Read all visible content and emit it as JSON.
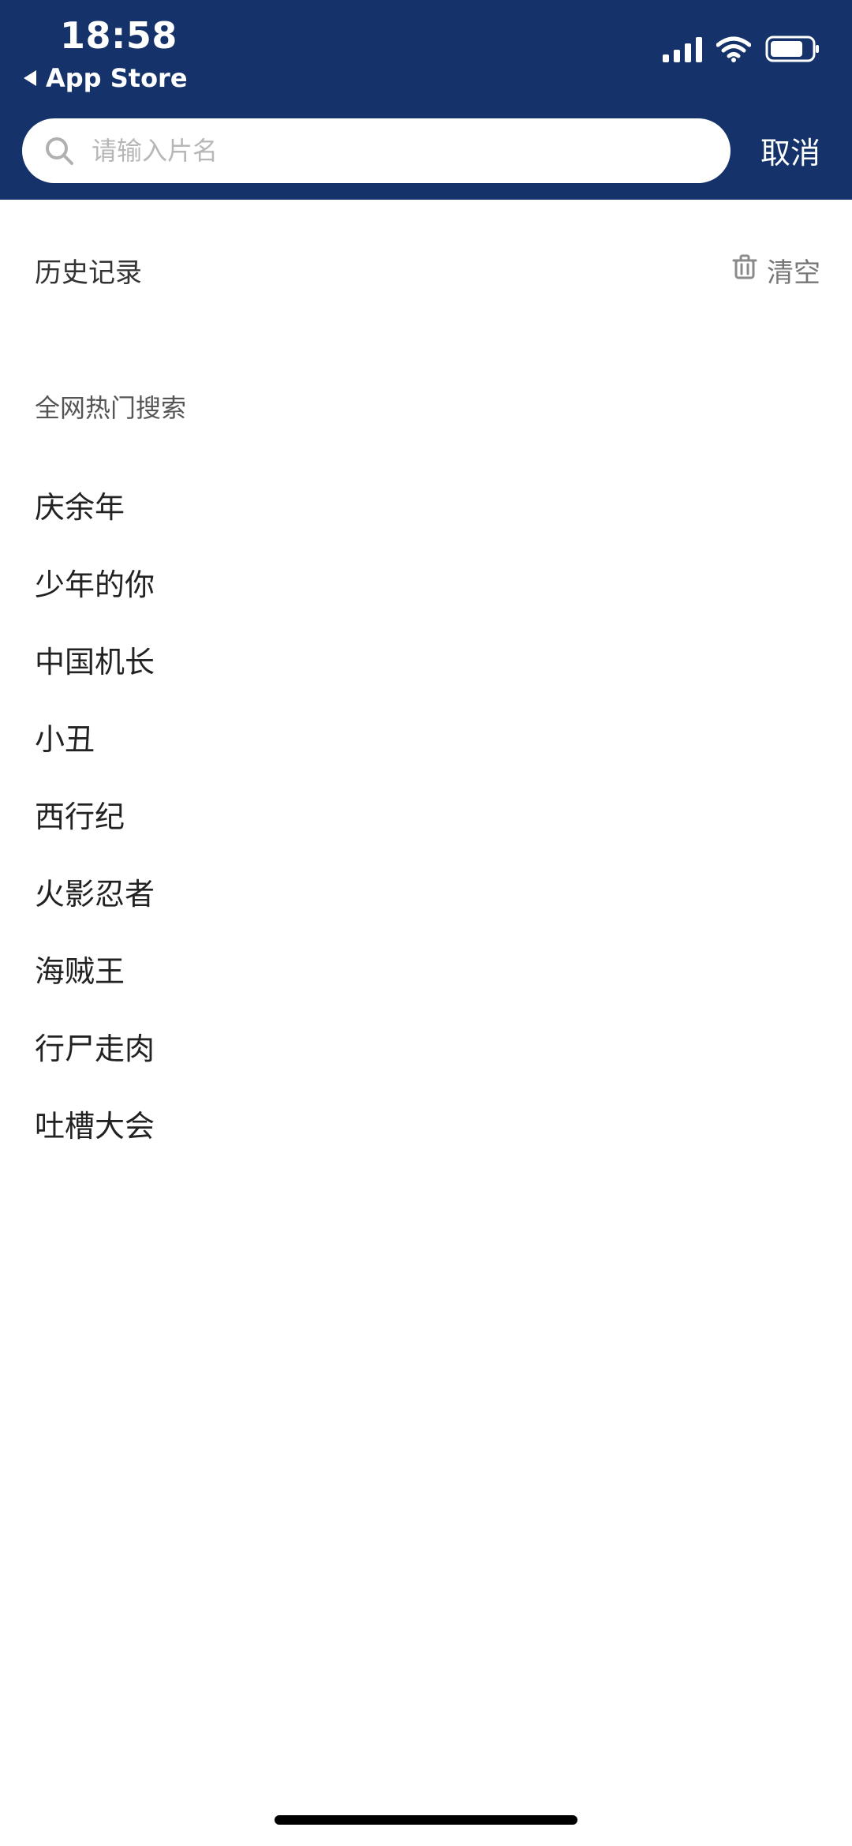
{
  "status": {
    "time": "18:58",
    "back_app": "App Store"
  },
  "search": {
    "placeholder": "请输入片名",
    "cancel_label": "取消"
  },
  "history": {
    "title": "历史记录",
    "clear_label": "清空"
  },
  "hot": {
    "title": "全网热门搜索",
    "items": [
      "庆余年",
      "少年的你",
      "中国机长",
      "小丑",
      "西行纪",
      "火影忍者",
      "海贼王",
      "行尸走肉",
      "吐槽大会"
    ]
  },
  "colors": {
    "header_bg": "#15336A",
    "text_primary": "#222222",
    "text_secondary": "#777777"
  },
  "icons": {
    "search": "search-icon",
    "trash": "trash-icon",
    "signal": "signal-icon",
    "wifi": "wifi-icon",
    "battery": "battery-icon",
    "back": "back-triangle-icon"
  }
}
